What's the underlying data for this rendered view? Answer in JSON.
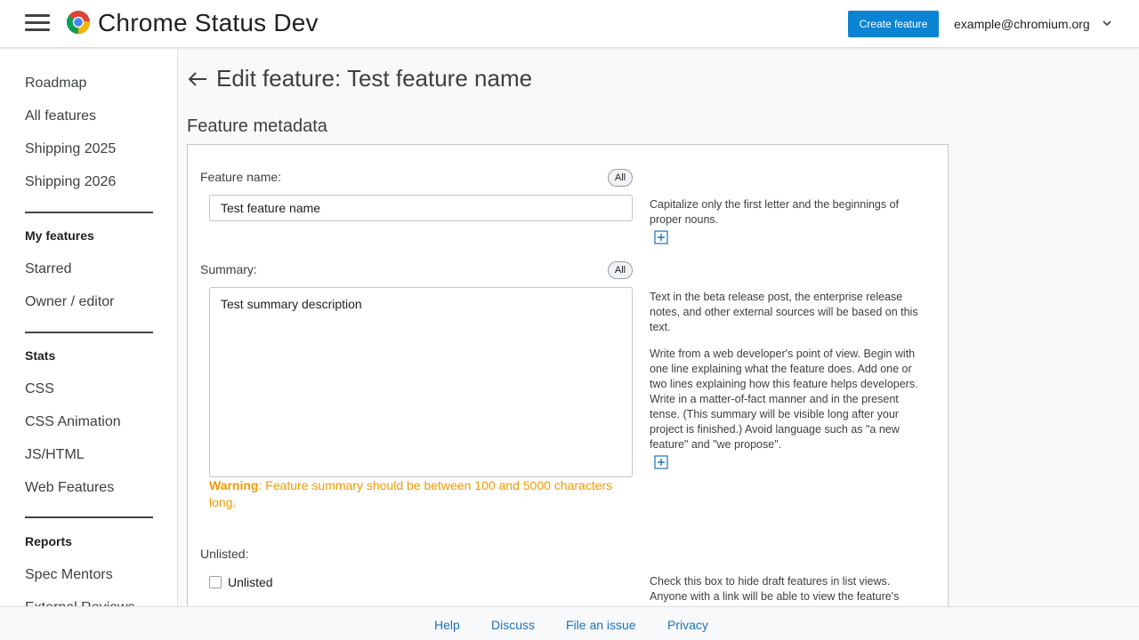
{
  "header": {
    "title": "Chrome Status Dev",
    "create_label": "Create feature",
    "user_email": "example@chromium.org",
    "menu_icon": "hamburger-menu-icon",
    "logo_icon": "chrome-logo-icon",
    "user_menu_icon": "chevron-down-icon"
  },
  "sidebar": {
    "items_top": [
      {
        "label": "Roadmap"
      },
      {
        "label": "All features"
      },
      {
        "label": "Shipping 2025"
      },
      {
        "label": "Shipping 2026"
      }
    ],
    "my_features_heading": "My features",
    "my_features": [
      {
        "label": "Starred"
      },
      {
        "label": "Owner / editor"
      }
    ],
    "stats_heading": "Stats",
    "stats": [
      {
        "label": "CSS"
      },
      {
        "label": "CSS Animation"
      },
      {
        "label": "JS/HTML"
      },
      {
        "label": "Web Features"
      }
    ],
    "reports_heading": "Reports",
    "reports": [
      {
        "label": "Spec Mentors"
      },
      {
        "label": "External Reviews"
      }
    ]
  },
  "main": {
    "page_title": "Edit feature: Test feature name",
    "section_title": "Feature metadata",
    "all_label": "All",
    "feature_name": {
      "label": "Feature name:",
      "value": "Test feature name",
      "help": "Capitalize only the first letter and the beginnings of proper nouns."
    },
    "summary": {
      "label": "Summary:",
      "value": "Test summary description",
      "help_1": "Text in the beta release post, the enterprise release notes, and other external sources will be based on this text.",
      "help_2": "Write from a web developer's point of view. Begin with one line explaining what the feature does. Add one or two lines explaining how this feature helps developers. Write in a matter-of-fact manner and in the present tense. (This summary will be visible long after your project is finished.) Avoid language such as \"a new feature\" and \"we propose\".",
      "warning_prefix": "Warning",
      "warning_text": ": Feature summary should be between 100 and 5000 characters long."
    },
    "unlisted": {
      "label": "Unlisted:",
      "checkbox_label": "Unlisted",
      "help": "Check this box to hide draft features in list views. Anyone with a link will be able to view the feature's detail page."
    }
  },
  "footer": {
    "links": [
      {
        "label": "Help"
      },
      {
        "label": "Discuss"
      },
      {
        "label": "File an issue"
      },
      {
        "label": "Privacy"
      }
    ]
  },
  "colors": {
    "accent": "#0b84d3",
    "warning": "#f29900",
    "link": "#1a73b8"
  }
}
